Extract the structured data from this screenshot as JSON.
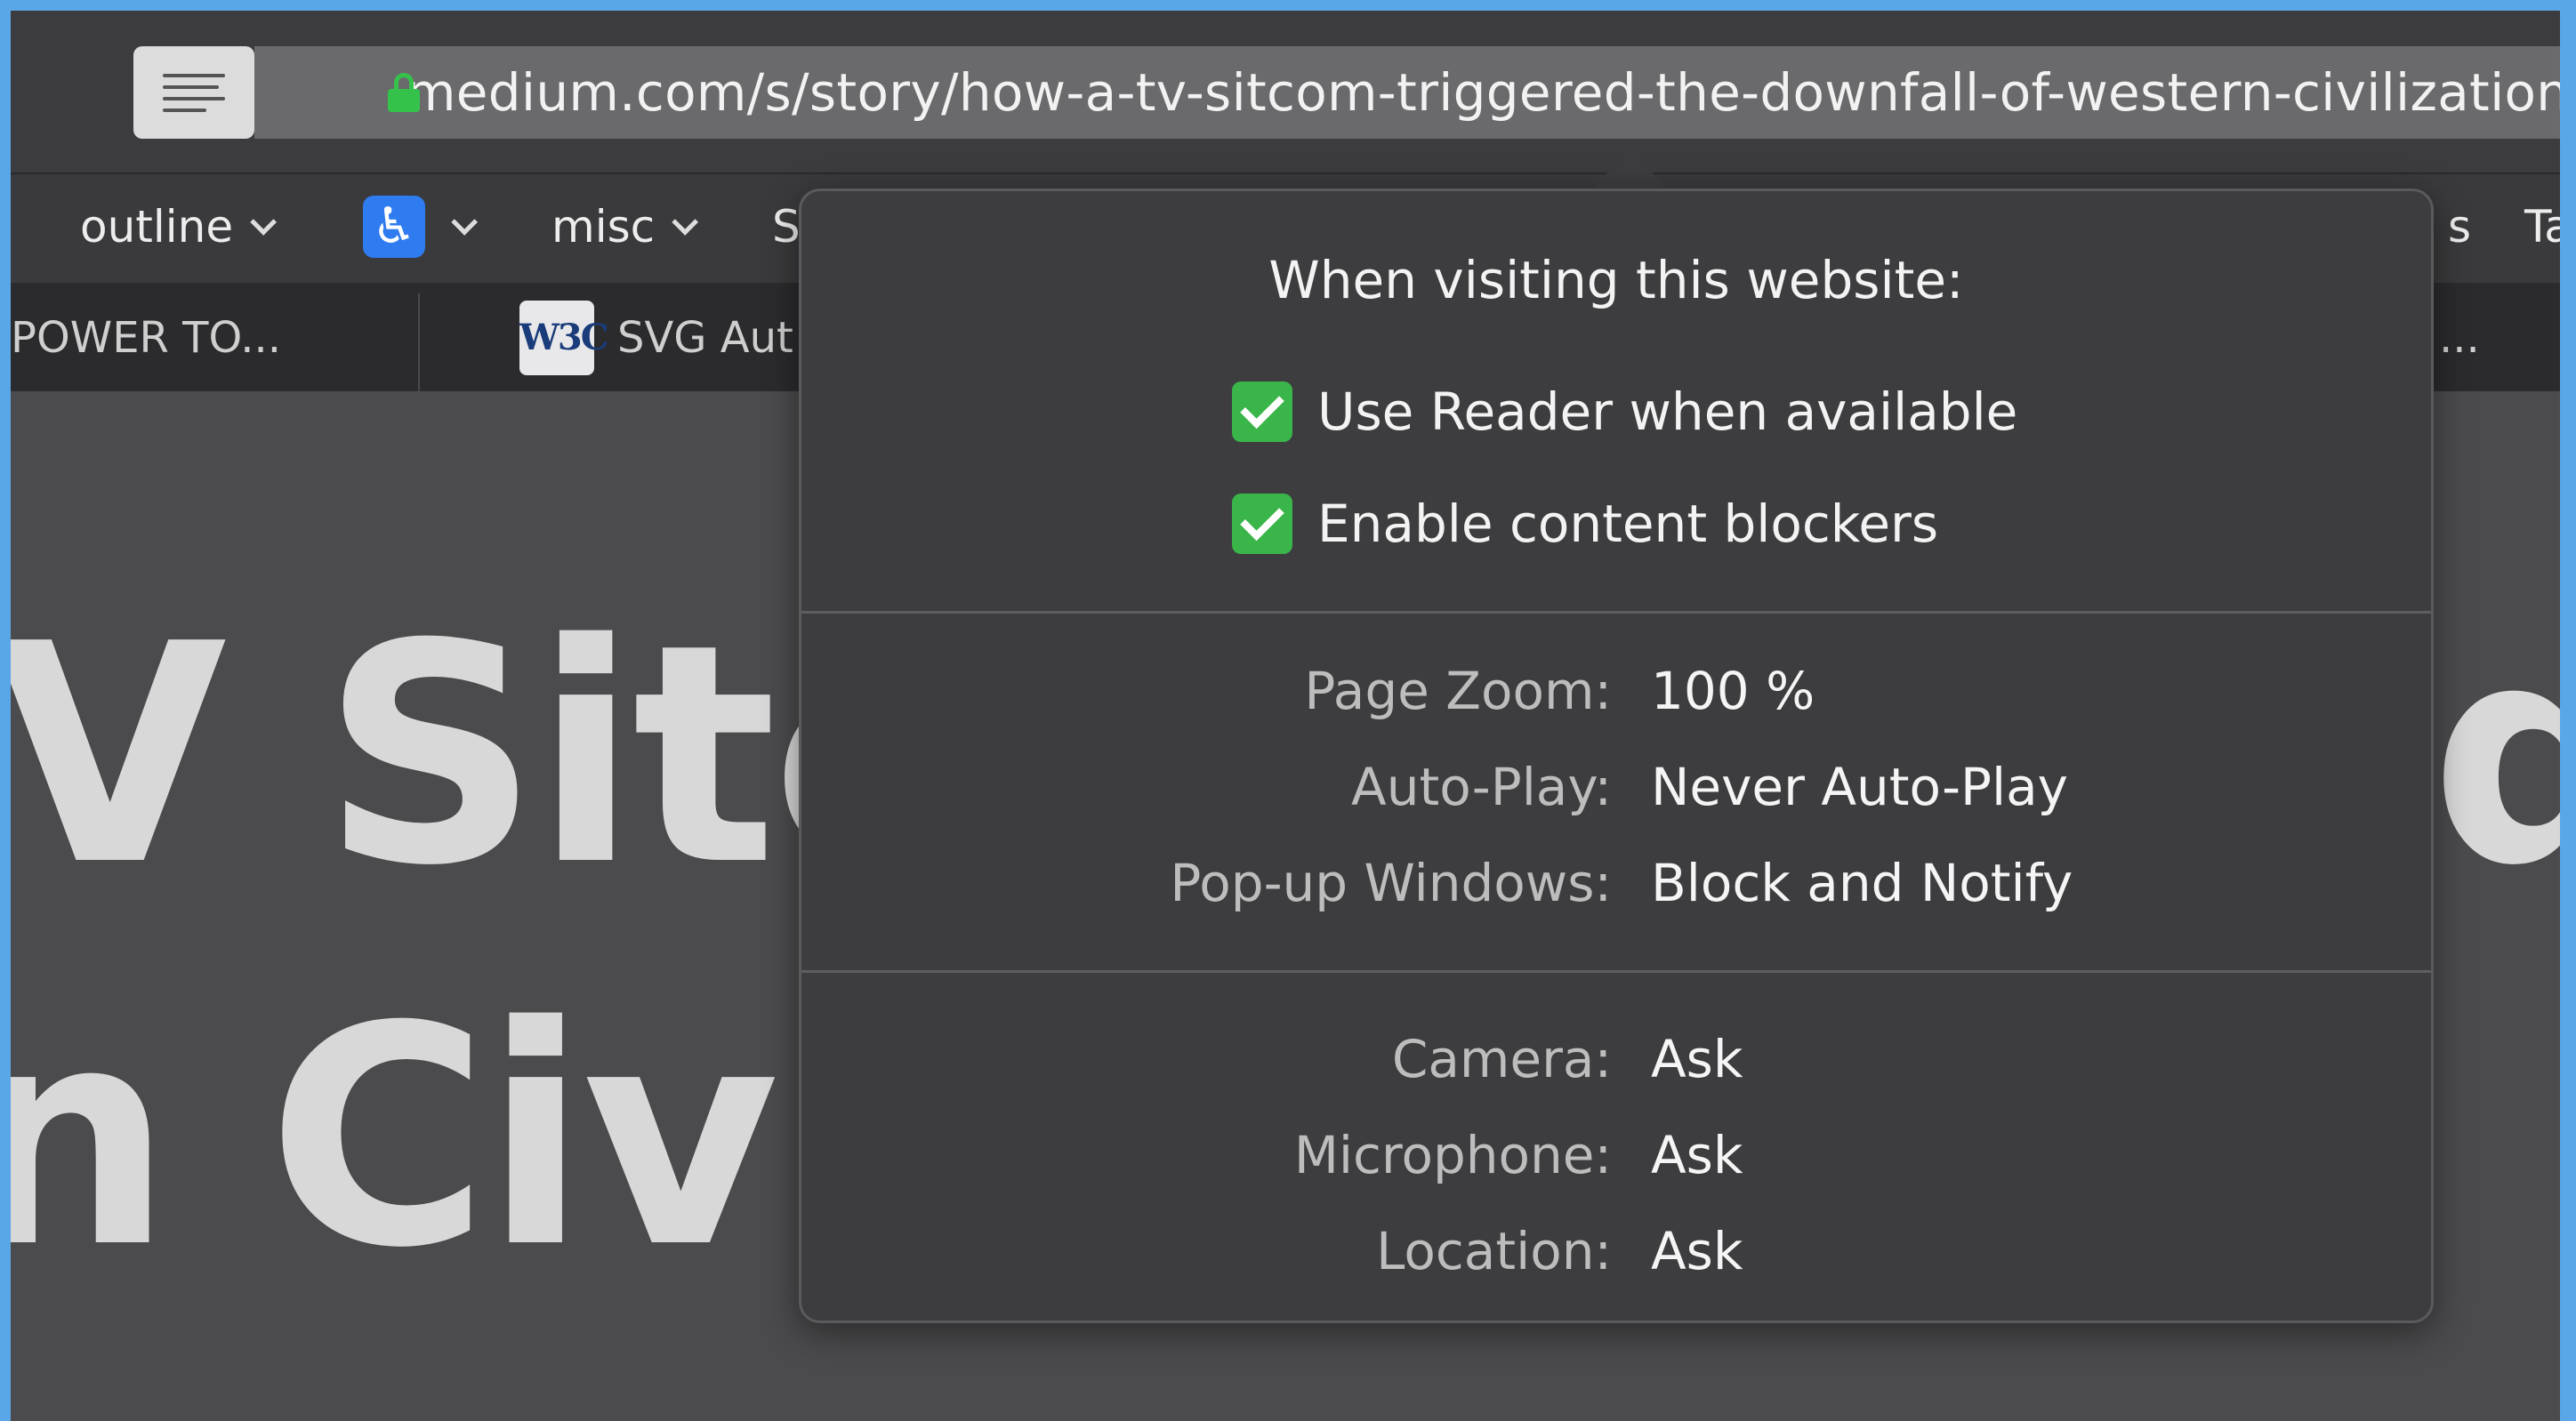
{
  "browser": {
    "url": "medium.com/s/story/how-a-tv-sitcom-triggered-the-downfall-of-western-civilization-",
    "icons": {
      "reader": "reader-view-icon",
      "lock": "lock-icon"
    },
    "accent_secure": "#35c24b"
  },
  "bookmarks": {
    "outline": "outline",
    "accessibility_icon": "♿",
    "misc": "misc",
    "partial_s": "S",
    "right_s": "s",
    "right_ta": "Ta"
  },
  "favorites": {
    "left": "POWER TO...",
    "w3c_icon": "W3C",
    "svg": "SVG Aut",
    "right": "..."
  },
  "page": {
    "headline_line1_left": "V Sitco",
    "headline_line1_right": "d",
    "headline_line2_left": "n Civili"
  },
  "popover": {
    "title": "When visiting this website:",
    "checkboxes": [
      {
        "label": "Use Reader when available",
        "checked": true
      },
      {
        "label": "Enable content blockers",
        "checked": true
      }
    ],
    "general": [
      {
        "label": "Page Zoom:",
        "value": "100 %"
      },
      {
        "label": "Auto-Play:",
        "value": "Never Auto-Play"
      },
      {
        "label": "Pop-up Windows:",
        "value": "Block and Notify"
      }
    ],
    "permissions": [
      {
        "label": "Camera:",
        "value": "Ask"
      },
      {
        "label": "Microphone:",
        "value": "Ask"
      },
      {
        "label": "Location:",
        "value": "Ask"
      }
    ],
    "checkbox_color": "#3ab54a"
  }
}
